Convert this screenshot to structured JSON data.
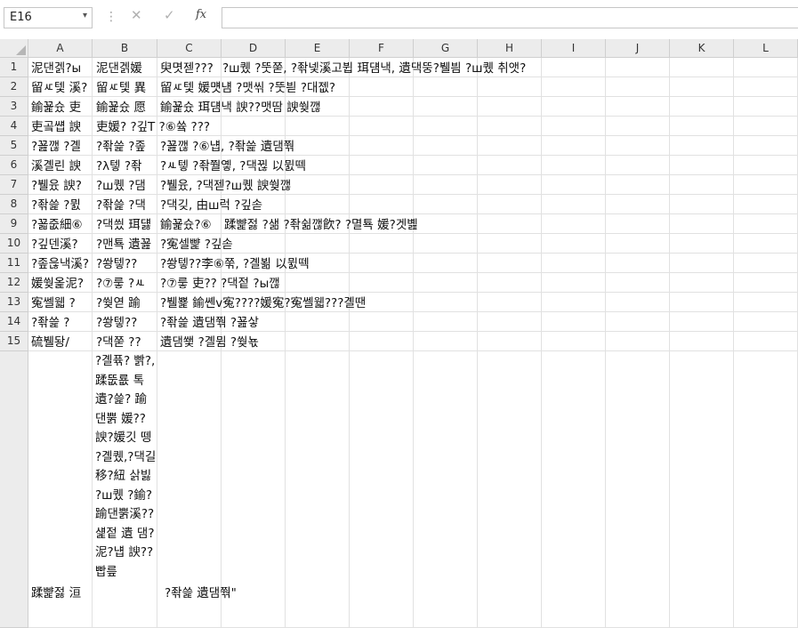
{
  "namebox": {
    "value": "E16",
    "dropdown_glyph": "▾"
  },
  "formula_bar": {
    "separator": "⋮",
    "cancel_glyph": "✕",
    "enter_glyph": "✓",
    "fx_label": "fx",
    "value": ""
  },
  "columns": [
    "A",
    "B",
    "C",
    "D",
    "E",
    "F",
    "G",
    "H",
    "I",
    "J",
    "K",
    "L"
  ],
  "rows": [
    "1",
    "2",
    "3",
    "4",
    "5",
    "6",
    "7",
    "8",
    "9",
    "10",
    "11",
    "12",
    "13",
    "14",
    "15",
    ""
  ],
  "cells": {
    "A1": "泥댄겕?ы",
    "B1": "泥댄겕媛 ",
    "C1": "臾몃젣???",
    "C1_overflow": "?ш퀬 ?뚯쭏, ?좎넻溪고뷥 珥덈낵, 遺댁뚱?뷀븸 ?ш퀬 취앳?",
    "A2": "留ㅼ텣 溪?",
    "B2": "留ㅼ텣 異",
    "C2": "留ㅼ텣 媛먯냼 ?맷씪 ?뚯븯 ?대젮?",
    "A3": "鍮꾩슜 吏",
    "B3": "鍮꾩슜 愿",
    "C3": "鍮꾩슜 珥덈낵 諛??맷땀 諛쒖깮",
    "A4": "吏곸썝 諛",
    "B4": "吏媛? ?깊T ?⑥쓬 ???",
    "A5": "?꾪깮 ?곌",
    "B5": "?좎쓽 ?좊",
    "C5": "?꾪깮 ?⑥냽, ?좎쓽 遺댐쭦",
    "A6": "溪곌린 諛",
    "B6": "?λ텧 ?좎",
    "C6": "?ㅻ텧 ?좎쭬옣, ?댁뀒 以뮔떽",
    "A7": "?뷀윴 諛?",
    "B7": "?ш퀬 ?댐",
    "C7": "?뷀윴, ?댁젣?ш퀬 諛쒖깮",
    "A8": "?좎쓽 ?뮔",
    "B8": "?좎쓽 ?댁",
    "C8": "?댁깆, 由ш럭 ?깊솓",
    "A9": "?꾧줎細⑥",
    "B9": "?댁씠 珥덇",
    "C9": "鍮꾩슜?⑥",
    "D9": "蹂뺥젏 ?샒 ?좎쉶깮飮? ?멸툑 媛?겟볦",
    "A10": "?깊덴溪?",
    "B10": "?맨툑 遺꾪",
    "C10": "?寃셀뺥 ?깊솓",
    "A11": "?좊읂낵溪?",
    "B11": "?쐉텧??",
    "C11": "?쐉텧??李⑥쭊, ?곌뵒 以뮔떽",
    "A12": "媛쒖옱泥?",
    "B12": "?⑦뤃 ?ㅻ",
    "C12": "?⑦뤃 吏?? ?댁젙 ?ы깮",
    "A13": "寃쎌웳 ?",
    "B13": "?쒖엳 踰",
    "C13": "?뷀뾽 鍮쏀ⅴ寃????媛寃?寃쎌웳???곌땐",
    "A14": "?좎쓽 ?",
    "B14": "?쐉텧??",
    "C14": "?좎쓽 遺댐쭦 ?꾪샇",
    "A15": "硫뷀돵/",
    "B15": "?댁쭏 ??",
    "C15": "遺댐쐧 ?곌뮘 ?쒖뇫",
    "A16": "蹂뺥젏 洹",
    "B16": "?곌퓪? 빩?, 蹂뚮룞 톡 遺?쓽? 踰댄뿕 媛??諛?媛깃 뗑 ?곌퀬,?댁길移?紐 삵빓 ?ш퀬 ?鍮?踰댄뿕溪?? 섍젙 遺 댐? 泥?냽 諛??빱릎",
    "C16": "?좎쓽 遺댐쭦\""
  }
}
